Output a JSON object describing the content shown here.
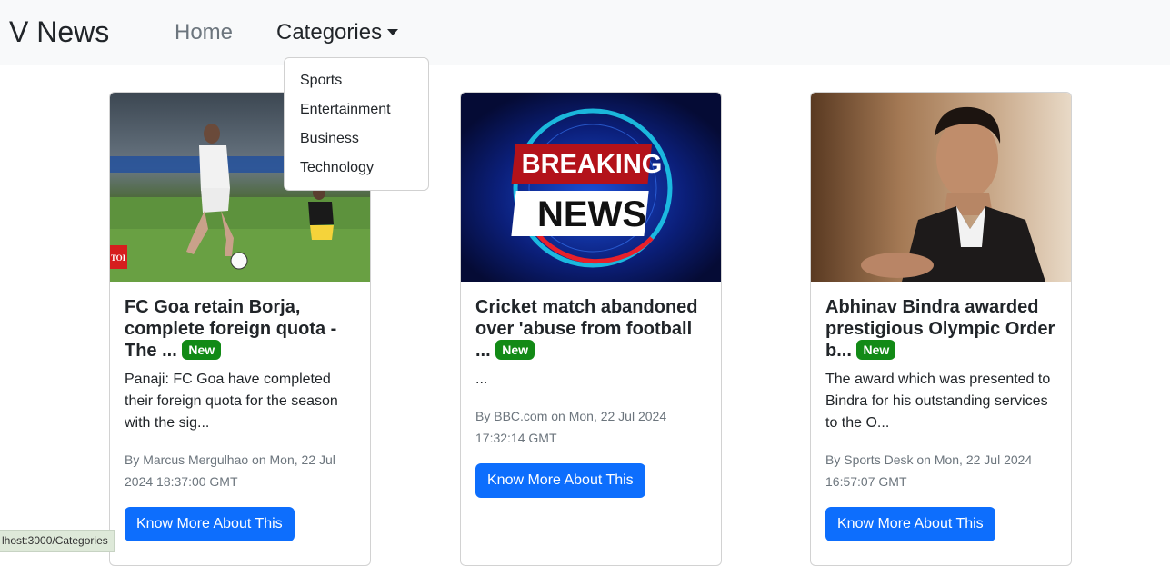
{
  "navbar": {
    "brand": "V News",
    "home": "Home",
    "categories": "Categories",
    "dropdown": [
      "Sports",
      "Entertainment",
      "Business",
      "Technology"
    ]
  },
  "cards": [
    {
      "title": "FC Goa retain Borja, complete foreign quota - The ...",
      "badge": "New",
      "description": "Panaji: FC Goa have completed their foreign quota for the season with the sig...",
      "meta": "By Marcus Mergulhao on Mon, 22 Jul 2024 18:37:00 GMT",
      "button": "Know More About This",
      "image_logo": "TOI"
    },
    {
      "title": "Cricket match abandoned over 'abuse from football ...",
      "badge": "New",
      "description": "...",
      "meta": "By BBC.com on Mon, 22 Jul 2024 17:32:14 GMT",
      "button": "Know More About This",
      "image_text_1": "BREAKING",
      "image_text_2": "NEWS"
    },
    {
      "title": "Abhinav Bindra awarded prestigious Olympic Order b...",
      "badge": "New",
      "description": "The award which was presented to Bindra for his outstanding services to the O...",
      "meta": "By Sports Desk on Mon, 22 Jul 2024 16:57:07 GMT",
      "button": "Know More About This"
    }
  ],
  "status_bar": "lhost:3000/Categories",
  "colors": {
    "primary": "#0d6efd",
    "badge": "#128a16",
    "navbar_bg": "#f8f9fa"
  }
}
